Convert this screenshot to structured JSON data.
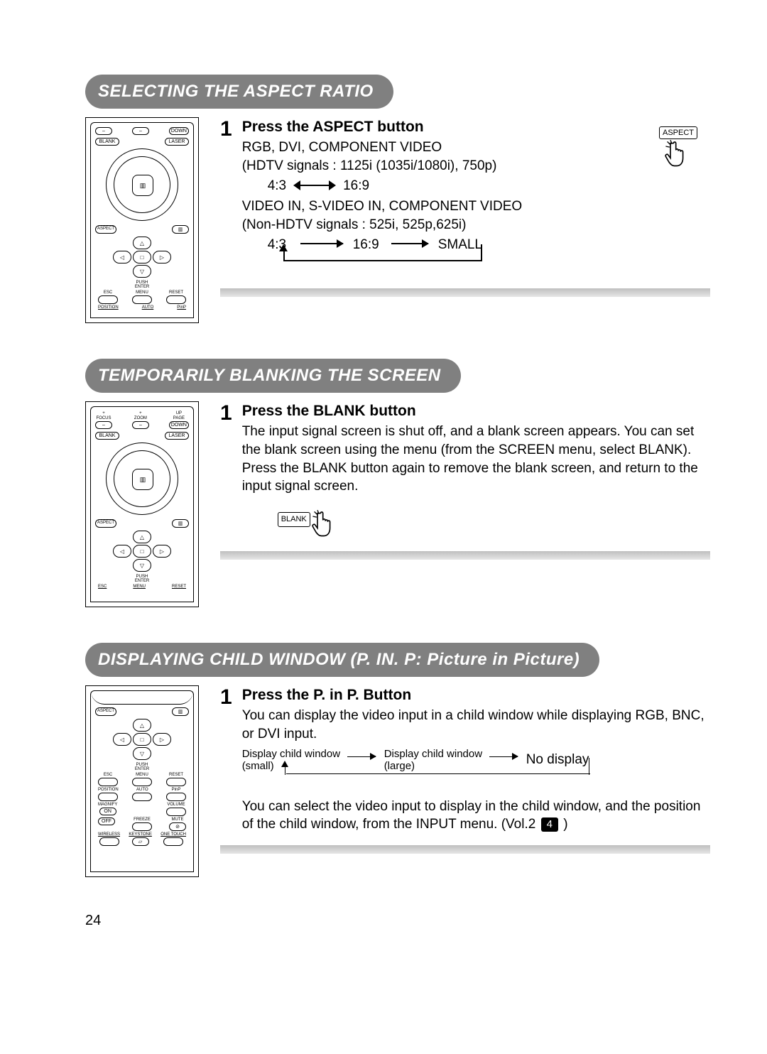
{
  "page_number": "24",
  "sections": {
    "aspect": {
      "heading": "SELECTING THE ASPECT RATIO",
      "step_num": "1",
      "step_title": "Press the ASPECT button",
      "line_rgb": "RGB, DVI, COMPONENT VIDEO",
      "line_hdtv": "(HDTV signals : 1125i (1035i/1080i), 750p)",
      "ratio_a": "4:3",
      "ratio_b": "16:9",
      "line_video": "VIDEO IN, S-VIDEO IN, COMPONENT VIDEO",
      "line_nonhdtv": "(Non-HDTV signals : 525i, 525p,625i)",
      "loop_a": "4:3",
      "loop_b": "16:9",
      "loop_c": "SMALL",
      "button_box": "ASPECT"
    },
    "blank": {
      "heading": "TEMPORARILY BLANKING THE SCREEN",
      "step_num": "1",
      "step_title": "Press the BLANK button",
      "body": "The input signal screen is shut off, and a blank screen appears. You can set the blank screen using the menu (from the SCREEN menu, select BLANK). Press the BLANK button again to remove the blank screen, and return to the input signal screen.",
      "button_box": "BLANK"
    },
    "pinp": {
      "heading": "DISPLAYING CHILD WINDOW (P. IN. P: Picture in Picture)",
      "step_num": "1",
      "step_title": "Press the P. in P. Button",
      "intro": "You can display the video input in a child window while displaying RGB, BNC, or DVI input.",
      "cycle_small_a": "Display child window",
      "cycle_small_b": "(small)",
      "cycle_large_a": "Display child window",
      "cycle_large_b": "(large)",
      "cycle_none": "No display",
      "after_a": "You can select the video input to display in the child window, and the position of the child window, from the INPUT menu. (Vol.2 ",
      "vol_badge": "4",
      "after_b": " )"
    }
  },
  "remote": {
    "blank": "BLANK",
    "laser": "LASER",
    "aspect": "ASPECT",
    "push_enter": "PUSH\nENTER",
    "esc": "ESC",
    "menu": "MENU",
    "reset": "RESET",
    "position": "POSITION",
    "auto": "AUTO",
    "pinp": "PinP",
    "focus": "FOCUS",
    "zoom": "ZOOM",
    "page": "PAGE",
    "up": "UP",
    "down": "DOWN",
    "magnify": "MAGNIFY",
    "on": "ON",
    "off": "OFF",
    "volume": "VOLUME",
    "freeze": "FREEZE",
    "mute": "MUTE",
    "wireless": "WIRELESS",
    "keystone": "KEYSTONE",
    "onetouch": "ONE TOUCH"
  }
}
